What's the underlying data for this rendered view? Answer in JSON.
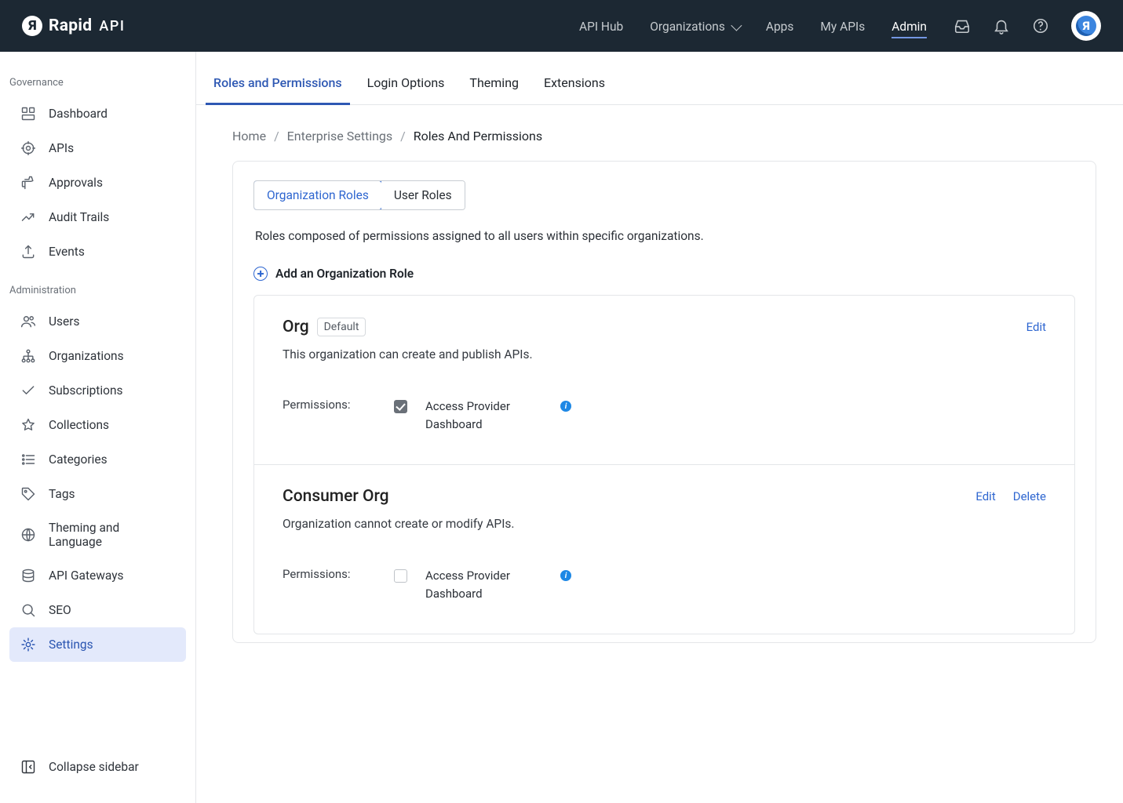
{
  "brand": {
    "name": "Rapid",
    "suffix": "API"
  },
  "header_nav": [
    {
      "label": "API Hub",
      "active": false,
      "dropdown": false
    },
    {
      "label": "Organizations",
      "active": false,
      "dropdown": true
    },
    {
      "label": "Apps",
      "active": false,
      "dropdown": false
    },
    {
      "label": "My APIs",
      "active": false,
      "dropdown": false
    },
    {
      "label": "Admin",
      "active": true,
      "dropdown": false
    }
  ],
  "sidebar": {
    "sections": [
      {
        "title": "Governance",
        "items": [
          {
            "label": "Dashboard",
            "icon": "grid"
          },
          {
            "label": "APIs",
            "icon": "target"
          },
          {
            "label": "Approvals",
            "icon": "thumb"
          },
          {
            "label": "Audit Trails",
            "icon": "trend"
          },
          {
            "label": "Events",
            "icon": "upload"
          }
        ]
      },
      {
        "title": "Administration",
        "items": [
          {
            "label": "Users",
            "icon": "users"
          },
          {
            "label": "Organizations",
            "icon": "tree"
          },
          {
            "label": "Subscriptions",
            "icon": "check"
          },
          {
            "label": "Collections",
            "icon": "star"
          },
          {
            "label": "Categories",
            "icon": "list"
          },
          {
            "label": "Tags",
            "icon": "tag"
          },
          {
            "label": "Theming and Language",
            "icon": "globe"
          },
          {
            "label": "API Gateways",
            "icon": "db"
          },
          {
            "label": "SEO",
            "icon": "search"
          },
          {
            "label": "Settings",
            "icon": "gear",
            "active": true
          }
        ]
      }
    ],
    "collapse": "Collapse sidebar"
  },
  "sub_tabs": [
    {
      "label": "Roles and Permissions",
      "active": true
    },
    {
      "label": "Login Options"
    },
    {
      "label": "Theming"
    },
    {
      "label": "Extensions"
    }
  ],
  "breadcrumbs": [
    {
      "label": "Home"
    },
    {
      "label": "Enterprise Settings"
    },
    {
      "label": "Roles And Permissions",
      "current": true
    }
  ],
  "role_tabs": [
    {
      "label": "Organization Roles",
      "active": true
    },
    {
      "label": "User Roles"
    }
  ],
  "roles_desc": "Roles composed of permissions assigned to all users within specific organizations.",
  "add_role_label": "Add an Organization Role",
  "permissions_word": "Permissions:",
  "edit_word": "Edit",
  "delete_word": "Delete",
  "roles": [
    {
      "name": "Org",
      "default": true,
      "default_badge": "Default",
      "description": "This organization can create and publish APIs.",
      "perm": {
        "label": "Access Provider Dashboard",
        "checked": true
      },
      "can_delete": false
    },
    {
      "name": "Consumer Org",
      "default": false,
      "description": "Organization cannot create or modify APIs.",
      "perm": {
        "label": "Access Provider Dashboard",
        "checked": false
      },
      "can_delete": true
    }
  ]
}
